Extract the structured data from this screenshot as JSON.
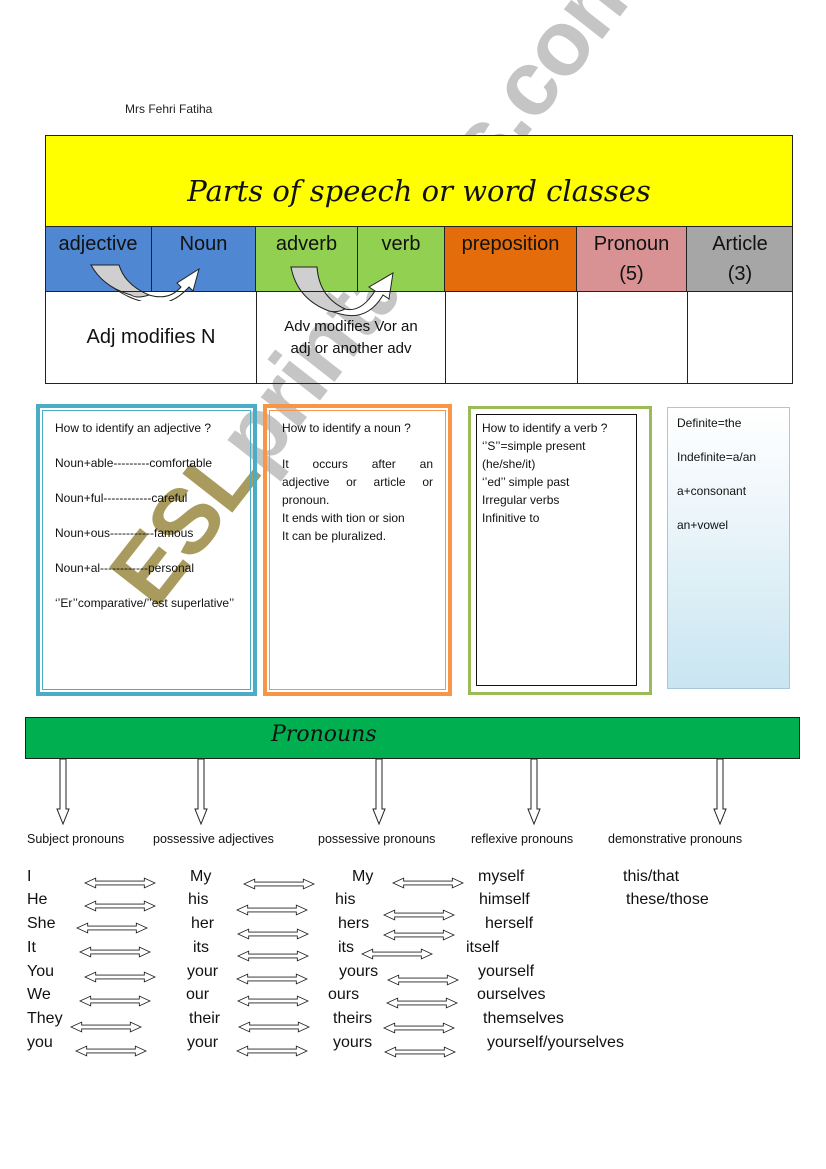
{
  "author": "Mrs Fehri Fatiha",
  "title": "Parts of speech  or word classes",
  "categories": [
    {
      "label": "adjective",
      "color": "#4f87d3"
    },
    {
      "label": "Noun",
      "color": "#4f87d3"
    },
    {
      "label": "adverb",
      "color": "#91d050"
    },
    {
      "label": "verb",
      "color": "#91d050"
    },
    {
      "label": "preposition",
      "color": "#e46c0a"
    },
    {
      "label": "Pronoun (5)",
      "line1": "Pronoun",
      "line2": "(5)",
      "color": "#d99294"
    },
    {
      "label": "Article (3)",
      "line1": "Article",
      "line2": "(3)",
      "color": "#a6a6a6"
    }
  ],
  "definitions": {
    "adjective_noun": "Adj modifies N",
    "adverb_verb_line1": "Adv modifies Vor an",
    "adverb_verb_line2": "adj or another adv",
    "preposition": "",
    "pronoun": "",
    "article": ""
  },
  "boxes": {
    "adjective": {
      "heading": "How to identify an adjective ?",
      "lines": [
        "Noun+able---------comfortable",
        "Noun+ful------------careful",
        "Noun+ous-----------famous",
        "Noun+al------------personal",
        "‘’Er’’comparative/’’est superlative’’"
      ]
    },
    "noun": {
      "heading": "How to identify a noun ?",
      "just_lines": [
        "It occurs after an",
        "adjective or article or"
      ],
      "lines": [
        "pronoun.",
        "It ends with tion or sion",
        "It can be pluralized."
      ]
    },
    "verb": {
      "heading": "How to identify a verb ?",
      "lines": [
        "‘’S’’=simple present",
        "(he/she/it)",
        "‘’ed’’ simple past",
        "Irregular verbs",
        "Infinitive to"
      ]
    },
    "article": {
      "lines": [
        "Definite=the",
        "Indefinite=a/an",
        "a+consonant",
        "an+vowel"
      ]
    }
  },
  "pronouns": {
    "title": "Pronouns",
    "categories": [
      "Subject pronouns",
      "possessive adjectives",
      "possessive pronouns",
      "reflexive pronouns",
      "demonstrative pronouns"
    ],
    "rows": [
      [
        "I",
        "My",
        "My",
        "myself",
        "this/that"
      ],
      [
        "He",
        "his",
        "his",
        "himself",
        "these/those"
      ],
      [
        "She",
        "her",
        "hers",
        "herself",
        ""
      ],
      [
        "It",
        "its",
        "its",
        "itself",
        ""
      ],
      [
        "You",
        "your",
        "yours",
        "yourself",
        ""
      ],
      [
        "We",
        "our",
        "ours",
        "ourselves",
        ""
      ],
      [
        "They",
        "their",
        "theirs",
        "themselves",
        ""
      ],
      [
        "you",
        "your",
        "yours",
        "yourself/yourselves",
        ""
      ]
    ]
  },
  "watermark": {
    "prefix": "ESL",
    "rest": "printables.com"
  }
}
